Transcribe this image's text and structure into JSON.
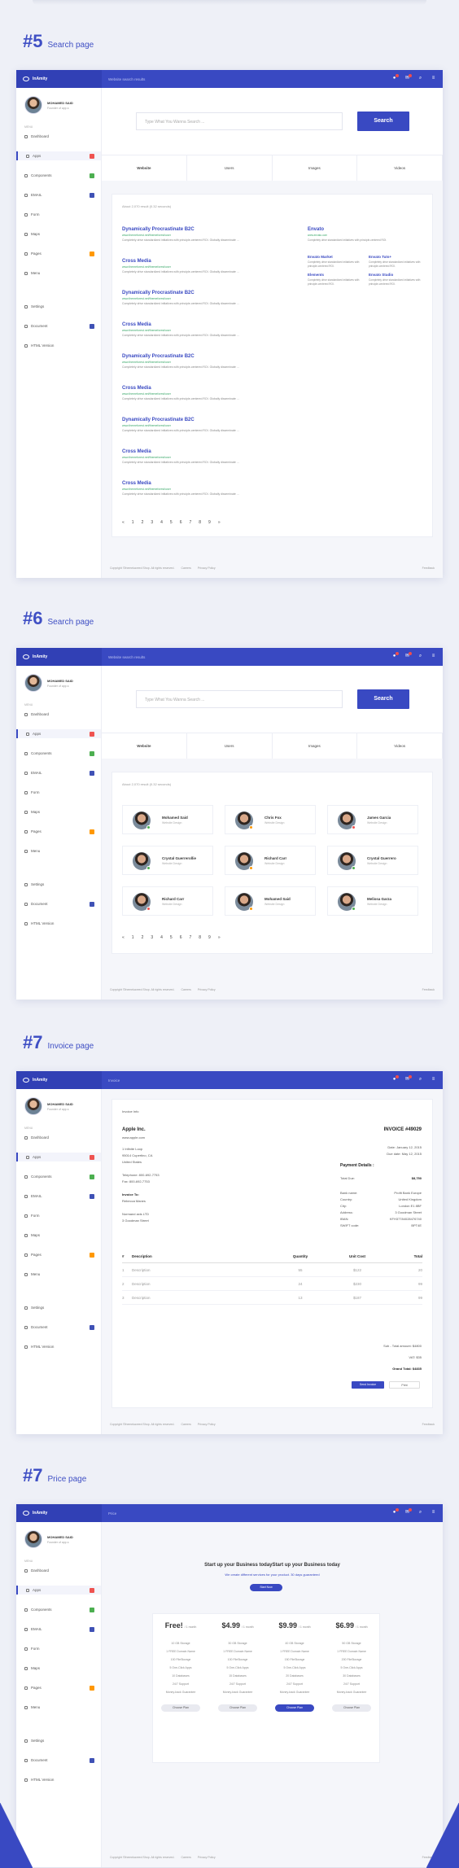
{
  "app": {
    "brand": "InAmity",
    "user_name": "MOHAMED SAID",
    "user_role": "Founder of app.s"
  },
  "sidebar": {
    "subtitle": "MENU",
    "items": [
      {
        "label": "Dashboard"
      },
      {
        "label": "Apps"
      },
      {
        "label": "Components"
      },
      {
        "label": "EMAIL"
      },
      {
        "label": "Form"
      },
      {
        "label": "Maps"
      },
      {
        "label": "Pages"
      },
      {
        "label": "Menu"
      },
      {
        "label": "Settings"
      },
      {
        "label": "Document"
      },
      {
        "label": "HTML Version"
      }
    ],
    "badge_colors": [
      "#ef5350",
      "#4caf50",
      "#3f51b5",
      "#ff9800",
      "#3f51b5"
    ]
  },
  "sections": [
    {
      "num": "#5",
      "title": "Search page",
      "crumb": "Website search results"
    },
    {
      "num": "#6",
      "title": "Search page",
      "crumb": "Website search results"
    },
    {
      "num": "#7",
      "title": "Invoice page",
      "crumb": "Invoice"
    },
    {
      "num": "#7",
      "title": "Price page",
      "crumb": "Price"
    }
  ],
  "search": {
    "placeholder": "Type What You Wanna Search ...",
    "button": "Search",
    "tabs": [
      "Website",
      "Users",
      "Images",
      "Videos"
    ],
    "found": "About 2,070 result (0.32 seconds)",
    "results": [
      {
        "title": "Dynamically Procrastinate B2C",
        "url": "www.themeforest.net/themeforest/user"
      },
      {
        "title": "Cross Media",
        "url": "www.themeforest.net/themeforest/user"
      },
      {
        "title": "Dynamically Procrastinate B2C",
        "url": "www.themeforest.net/themeforest/user"
      },
      {
        "title": "Cross Media",
        "url": "www.themeforest.net/themeforest/user"
      },
      {
        "title": "Dynamically Procrastinate B2C",
        "url": "www.themeforest.net/themeforest/user"
      },
      {
        "title": "Cross Media",
        "url": "www.themeforest.net/themeforest/user"
      },
      {
        "title": "Dynamically Procrastinate B2C",
        "url": "www.themeforest.net/themeforest/user"
      },
      {
        "title": "Cross Media",
        "url": "www.themeforest.net/themeforest/user"
      },
      {
        "title": "Cross Media",
        "url": "www.themeforest.net/themeforest/user"
      }
    ],
    "desc": "Completely drive standardized initiatives with principle-centered ROI. Globally disseminate ...",
    "side": {
      "title": "Envato",
      "url": "www.envato.com",
      "desc": "Completely drive standardized initiatives with principle-centered ROI.",
      "links": [
        "Envato Market",
        "Envato Tuts+",
        "Elements",
        "Envato Studio"
      ]
    },
    "pages": [
      "«",
      "1",
      "2",
      "3",
      "4",
      "5",
      "6",
      "7",
      "8",
      "9",
      "»"
    ]
  },
  "users": {
    "found": "About 2,070 result (0.32 seconds)",
    "role": "Website Design",
    "list": [
      "Mohamed Said",
      "Chris Fox",
      "James Garcia",
      "Crystal Guerrerollie",
      "Richard Carr",
      "Crystal Guerrero",
      "Richard Carr",
      "Mohamed Said",
      "Melissa Garza"
    ],
    "status_colors": [
      "#4caf50",
      "#ff9800",
      "#ef5350",
      "#4caf50",
      "#ff9800",
      "#4caf50",
      "#ef5350",
      "#ff9800",
      "#4caf50"
    ]
  },
  "invoice": {
    "label": "Invoice Info",
    "company": "Apple Inc.",
    "website": "www.apple.com",
    "address": [
      "1 Infinite Loop",
      "95014 Cupertino, CA",
      "United States"
    ],
    "phone": "Telephone: 800-692-7753",
    "fax": "Fax: 800-692-7753",
    "to_label": "Invoice To:",
    "to_name": "Rebecca Manes",
    "to_address": [
      "Normand axis LTD",
      "3 Goodman Street"
    ],
    "number": "INVOICE #49029",
    "date": "Date: January 12, 2015",
    "due": "Due date: May 12, 2015",
    "payment_title": "Payment Details :",
    "total_due_label": "Total Due:",
    "total_due": "$8,750",
    "details": [
      [
        "Bank name:",
        "Profit Bank Europe"
      ],
      [
        "Country:",
        "United Kingdom"
      ],
      [
        "City:",
        "London E1 8BF"
      ],
      [
        "Address:",
        "3 Goodman Street"
      ],
      [
        "IBAN:",
        "KFH37784028476740"
      ],
      [
        "SWIFT code:",
        "BPT4E"
      ]
    ],
    "columns": [
      "#",
      "Description",
      "Quantity",
      "Unit Cost",
      "Total"
    ],
    "rows": [
      [
        "1",
        "Description",
        "55",
        "$122",
        "20"
      ],
      [
        "2",
        "Description",
        "24",
        "$230",
        "99"
      ],
      [
        "3",
        "Description",
        "13",
        "$187",
        "99"
      ]
    ],
    "subtotal": "Sub - Total amount: $4800",
    "vat": "VAT: $35",
    "grand": "Grand Total: $4835",
    "btn_send": "Send Invoice",
    "btn_print": "Print"
  },
  "price": {
    "title": "Start up your Business todayStart up your Business today",
    "subtitle": "We create different services for your product. 30 days guaranteed",
    "cta": "Start Now",
    "plans": [
      {
        "price": "Free!",
        "per": "/ 1 month",
        "lines": [
          "10 GB Storage",
          "1 FREE Domain Name",
          "100 FileStorage",
          "5 One-Click Apps",
          "10 Databases",
          "24/7 Support",
          "Money-back Guarantee"
        ],
        "btn": "Choose Plan"
      },
      {
        "price": "$4.99",
        "per": "/ 1 month",
        "lines": [
          "30 GB Storage",
          "1 FREE Domain Name",
          "100 FileStorage",
          "5 One-Click Apps",
          "15 Databases",
          "24/7 Support",
          "Money-back Guarantee"
        ],
        "btn": "Choose Plan"
      },
      {
        "price": "$9.99",
        "per": "/ 1 month",
        "lines": [
          "40 GB Storage",
          "1 FREE Domain Name",
          "150 FileStorage",
          "5 One-Click Apps",
          "20 Databases",
          "24/7 Support",
          "Money-back Guarantee"
        ],
        "btn": "Choose Plan"
      },
      {
        "price": "$6.99",
        "per": "/ 1 month",
        "lines": [
          "50 GB Storage",
          "1 FREE Domain Name",
          "200 FileStorage",
          "5 One-Click Apps",
          "30 Databases",
          "24/7 Support",
          "Money-back Guarantee"
        ],
        "btn": "Choose Plan"
      }
    ]
  },
  "footer": {
    "copyright": "Copyright ©themekaveed Shop. All rights reserved.",
    "links": [
      "Careers",
      "Privacy Policy"
    ],
    "feedback": "Feedback"
  }
}
